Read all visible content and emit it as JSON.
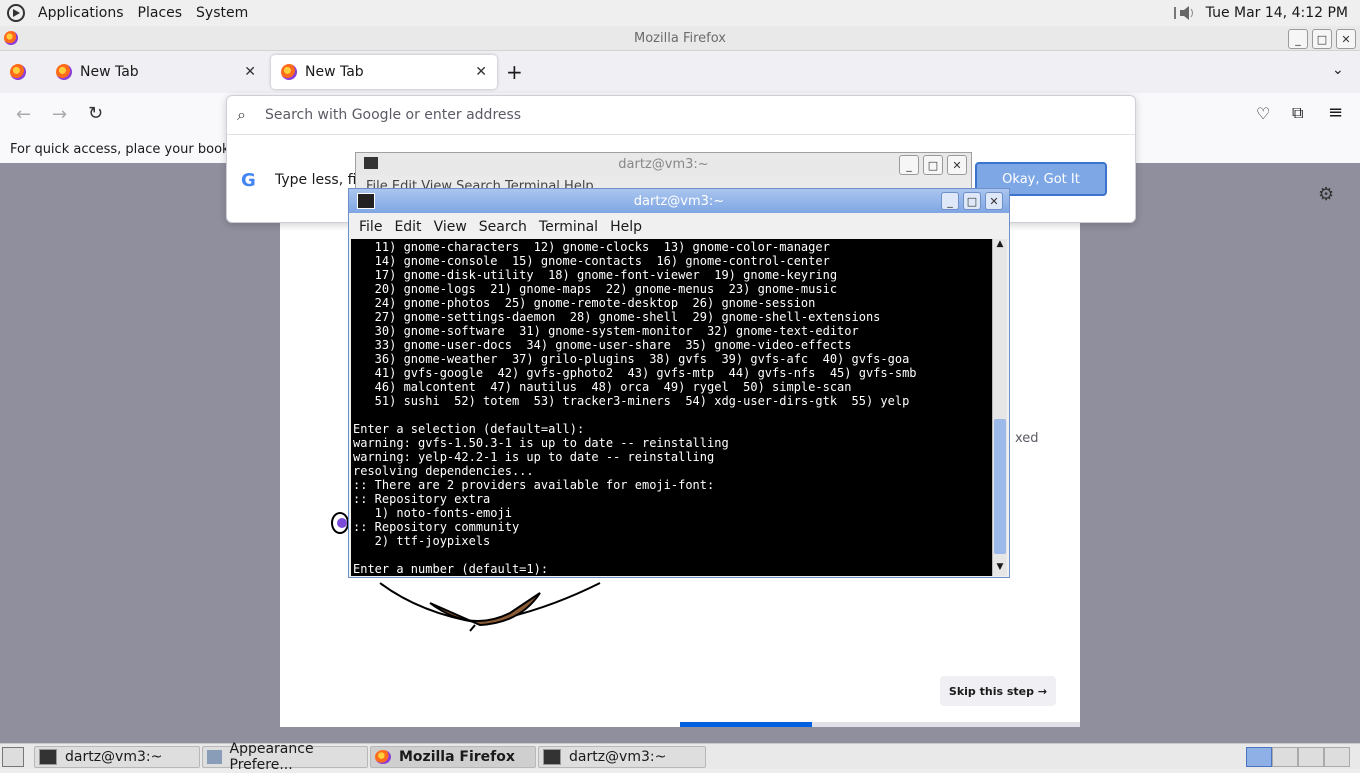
{
  "top_panel": {
    "menus": [
      "Applications",
      "Places",
      "System"
    ],
    "datetime": "Tue Mar 14,  4:12 PM"
  },
  "firefox": {
    "window_title": "Mozilla Firefox",
    "tabs": [
      {
        "label": "New Tab"
      },
      {
        "label": "New Tab"
      }
    ],
    "new_tab_symbol": "+",
    "url_placeholder": "Search with Google or enter address",
    "bookmarks_hint": "For quick access, place your bookma",
    "suggestion_text": "Type less, fin",
    "okay_button": "Okay, Got It",
    "skip_button": "Skip this step →",
    "faded_text": "xed",
    "progress_fraction": 0.33
  },
  "terminal_back": {
    "title": "dartz@vm3:~",
    "menu_strip": "File  Edit  View  Search  Terminal  Help"
  },
  "terminal": {
    "title": "dartz@vm3:~",
    "menu": [
      "File",
      "Edit",
      "View",
      "Search",
      "Terminal",
      "Help"
    ],
    "lines": [
      "   11) gnome-characters  12) gnome-clocks  13) gnome-color-manager",
      "   14) gnome-console  15) gnome-contacts  16) gnome-control-center",
      "   17) gnome-disk-utility  18) gnome-font-viewer  19) gnome-keyring",
      "   20) gnome-logs  21) gnome-maps  22) gnome-menus  23) gnome-music",
      "   24) gnome-photos  25) gnome-remote-desktop  26) gnome-session",
      "   27) gnome-settings-daemon  28) gnome-shell  29) gnome-shell-extensions",
      "   30) gnome-software  31) gnome-system-monitor  32) gnome-text-editor",
      "   33) gnome-user-docs  34) gnome-user-share  35) gnome-video-effects",
      "   36) gnome-weather  37) grilo-plugins  38) gvfs  39) gvfs-afc  40) gvfs-goa",
      "   41) gvfs-google  42) gvfs-gphoto2  43) gvfs-mtp  44) gvfs-nfs  45) gvfs-smb",
      "   46) malcontent  47) nautilus  48) orca  49) rygel  50) simple-scan",
      "   51) sushi  52) totem  53) tracker3-miners  54) xdg-user-dirs-gtk  55) yelp",
      "",
      "Enter a selection (default=all):",
      "warning: gvfs-1.50.3-1 is up to date -- reinstalling",
      "warning: yelp-42.2-1 is up to date -- reinstalling",
      "resolving dependencies...",
      ":: There are 2 providers available for emoji-font:",
      ":: Repository extra",
      "   1) noto-fonts-emoji",
      ":: Repository community",
      "   2) ttf-joypixels",
      "",
      "Enter a number (default=1):"
    ]
  },
  "taskbar": {
    "items": [
      {
        "label": "dartz@vm3:~"
      },
      {
        "label": "Appearance Prefere..."
      },
      {
        "label": "Mozilla Firefox"
      },
      {
        "label": "dartz@vm3:~"
      }
    ]
  }
}
